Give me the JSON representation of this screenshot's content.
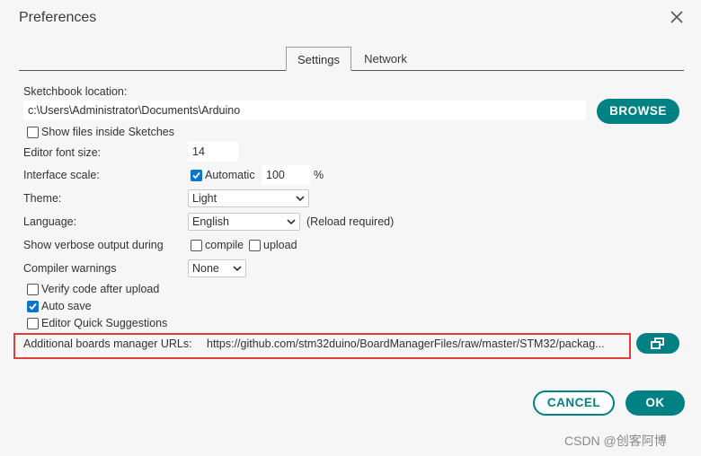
{
  "window": {
    "title": "Preferences"
  },
  "tabs": [
    {
      "label": "Settings"
    },
    {
      "label": "Network"
    }
  ],
  "sketchbook": {
    "label": "Sketchbook location:",
    "value": "c:\\Users\\Administrator\\Documents\\Arduino",
    "browse_label": "BROWSE"
  },
  "show_files": {
    "label": "Show files inside Sketches",
    "checked": false
  },
  "editor_font": {
    "label": "Editor font size:",
    "value": "14"
  },
  "interface_scale": {
    "label": "Interface scale:",
    "automatic_label": "Automatic",
    "automatic_checked": true,
    "value": "100",
    "unit": "%"
  },
  "theme": {
    "label": "Theme:",
    "selected": "Light"
  },
  "language": {
    "label": "Language:",
    "selected": "English",
    "note": "(Reload required)"
  },
  "verbose": {
    "label": "Show verbose output during",
    "compile_label": "compile",
    "upload_label": "upload",
    "compile_checked": false,
    "upload_checked": false
  },
  "compiler_warnings": {
    "label": "Compiler warnings",
    "selected": "None"
  },
  "options": [
    {
      "label": "Verify code after upload",
      "checked": false
    },
    {
      "label": "Auto save",
      "checked": true
    },
    {
      "label": "Editor Quick Suggestions",
      "checked": false
    }
  ],
  "boards_urls": {
    "label": "Additional boards manager URLs:",
    "value": "https://github.com/stm32duino/BoardManagerFiles/raw/master/STM32/packag..."
  },
  "footer": {
    "cancel_label": "CANCEL",
    "ok_label": "OK"
  },
  "watermark": "CSDN @创客阿博",
  "colors": {
    "accent": "#008184",
    "checkbox_checked": "#0b74cf",
    "highlight_box": "#e0403a"
  }
}
